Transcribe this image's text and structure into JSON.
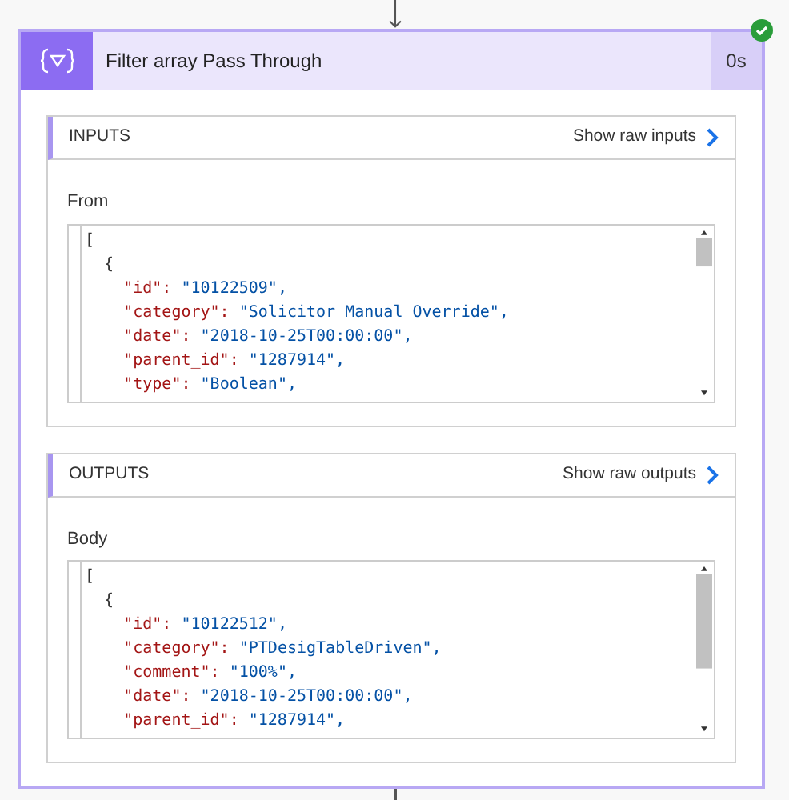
{
  "action": {
    "title": "Filter array Pass Through",
    "duration": "0s",
    "succeeded": true
  },
  "sections": [
    {
      "heading": "INPUTS",
      "link": "Show raw inputs",
      "field_label": "From",
      "code": [
        {
          "text": "[",
          "children": [
            {
              "text": "{",
              "children": [
                {
                  "key": "\"id\":",
                  "value": "\"10122509\","
                },
                {
                  "key": "\"category\":",
                  "value": "\"Solicitor Manual Override\","
                },
                {
                  "key": "\"date\":",
                  "value": "\"2018-10-25T00:00:00\","
                },
                {
                  "key": "\"parent_id\":",
                  "value": "\"1287914\","
                },
                {
                  "key": "\"type\":",
                  "value": "\"Boolean\","
                }
              ]
            }
          ]
        }
      ]
    },
    {
      "heading": "OUTPUTS",
      "link": "Show raw outputs",
      "field_label": "Body",
      "code": [
        {
          "text": "[",
          "children": [
            {
              "text": "{",
              "children": [
                {
                  "key": "\"id\":",
                  "value": "\"10122512\","
                },
                {
                  "key": "\"category\":",
                  "value": "\"PTDesigTableDriven\","
                },
                {
                  "key": "\"comment\":",
                  "value": "\"100%\","
                },
                {
                  "key": "\"date\":",
                  "value": "\"2018-10-25T00:00:00\","
                },
                {
                  "key": "\"parent_id\":",
                  "value": "\"1287914\","
                }
              ]
            }
          ]
        }
      ]
    }
  ]
}
